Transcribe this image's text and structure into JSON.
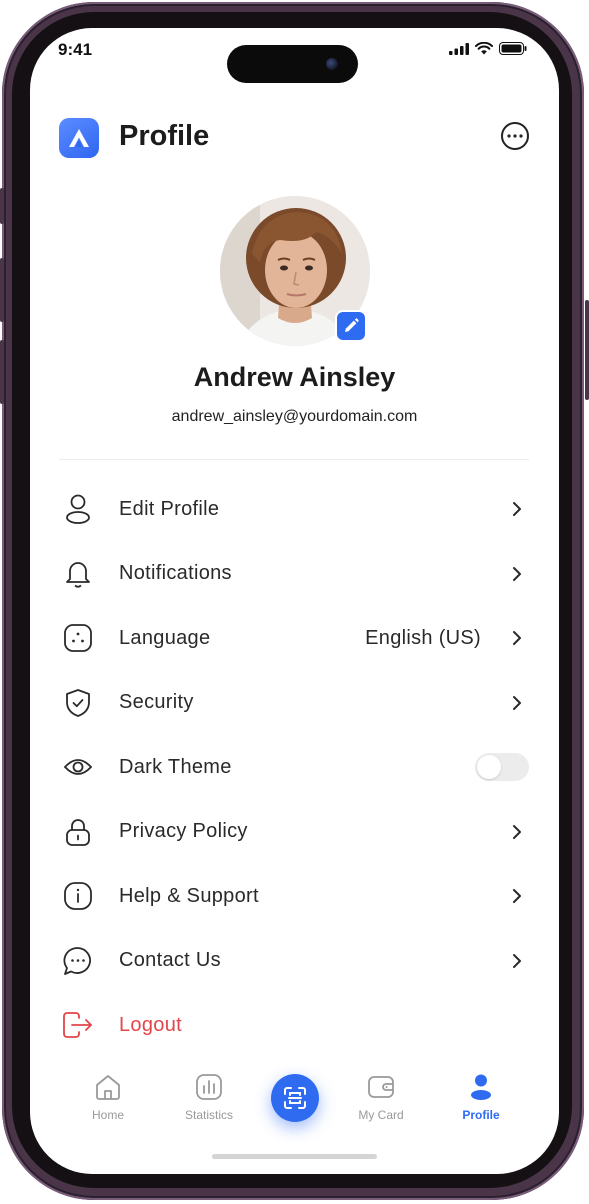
{
  "status_bar": {
    "time": "9:41"
  },
  "header": {
    "title": "Profile",
    "logo_icon": "app-logo-icon",
    "more_icon": "more-icon"
  },
  "profile": {
    "name": "Andrew Ainsley",
    "email": "andrew_ainsley@yourdomain.com"
  },
  "menu": {
    "items": [
      {
        "label": "Edit Profile",
        "icon": "user-icon"
      },
      {
        "label": "Notifications",
        "icon": "bell-icon"
      },
      {
        "label": "Language",
        "icon": "language-icon",
        "value": "English (US)"
      },
      {
        "label": "Security",
        "icon": "shield-icon"
      },
      {
        "label": "Dark Theme",
        "icon": "eye-icon",
        "toggle_on": false
      },
      {
        "label": "Privacy Policy",
        "icon": "lock-icon"
      },
      {
        "label": "Help & Support",
        "icon": "info-icon"
      },
      {
        "label": "Contact Us",
        "icon": "chat-icon"
      },
      {
        "label": "Logout",
        "icon": "logout-icon"
      }
    ]
  },
  "bottom_nav": {
    "items": [
      {
        "label": "Home",
        "icon": "home-icon"
      },
      {
        "label": "Statistics",
        "icon": "statistics-icon"
      },
      {
        "label": "My Card",
        "icon": "wallet-icon"
      },
      {
        "label": "Profile",
        "icon": "profile-icon",
        "active": true
      }
    ],
    "center_button_icon": "scan-icon"
  },
  "colors": {
    "accent": "#2f6bf0",
    "danger": "#e2464a",
    "text": "#2a2a2a",
    "frame": "#4a3548"
  }
}
